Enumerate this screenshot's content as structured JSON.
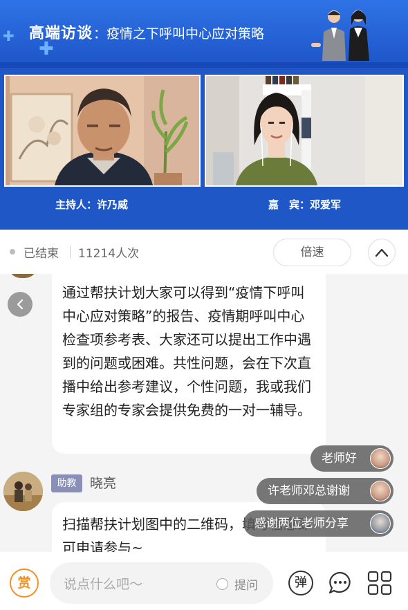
{
  "banner": {
    "title": "高端访谈",
    "subtitle": "：疫情之下呼叫中心应对策略"
  },
  "video": {
    "host_caption": "主持人：许乃威",
    "guest_caption": "嘉　宾：邓爱军"
  },
  "status": {
    "state": "已结束",
    "views": "11214人次",
    "speed_label": "倍速"
  },
  "messages": [
    {
      "text": "通过帮扶计划大家可以得到“疫情下呼叫中心应对策略”的报告、疫情期呼叫中心检查项参考表、大家还可以提出工作中遇到的问题或困难。共性问题，会在下次直播中给出参考建议，个性问题，我或我们专家组的专家会提供免费的一对一辅导。"
    },
    {
      "role_badge": "助教",
      "author": "晓亮",
      "text": "扫描帮扶计划图中的二维码，填写信息即可申请参与~"
    }
  ],
  "danmaku": [
    {
      "text": "老师好"
    },
    {
      "text": "许老师邓总谢谢"
    },
    {
      "text": "感谢两位老师分享"
    }
  ],
  "bottom": {
    "reward_label": "赏",
    "input_placeholder": "说点什么吧～",
    "ask_label": "提问",
    "danmu_label": "弹"
  },
  "icons": {
    "back": "chevron-left-icon",
    "collapse": "chevron-up-icon",
    "comment": "comment-icon",
    "grid": "grid-menu-icon"
  },
  "colors": {
    "banner_blue": "#1e56c9",
    "reward_orange": "#f29224",
    "badge_purple": "#8a8fb8"
  }
}
